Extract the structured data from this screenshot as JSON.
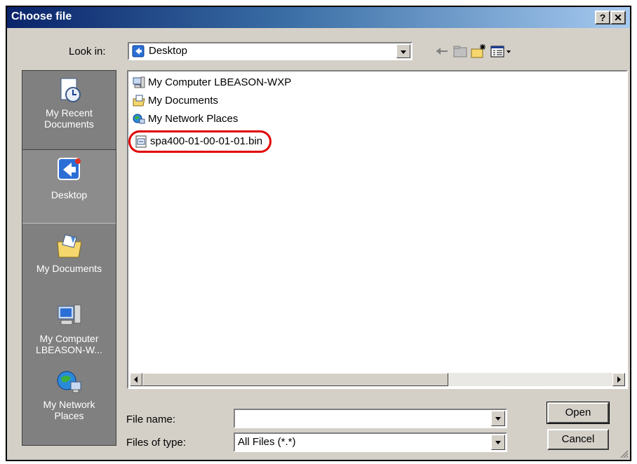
{
  "window": {
    "title": "Choose file",
    "help_button": "?",
    "close_button": "✕"
  },
  "toolbar": {
    "look_in_label": "Look in:",
    "look_in_value": "Desktop"
  },
  "places_bar": {
    "items": [
      {
        "label": "My Recent Documents",
        "icon": "recent-documents-icon"
      },
      {
        "label": "Desktop",
        "icon": "desktop-icon",
        "selected": true
      },
      {
        "label": "My Documents",
        "icon": "my-documents-icon"
      },
      {
        "label": "My Computer LBEASON-W...",
        "icon": "my-computer-icon"
      },
      {
        "label": "My Network Places",
        "icon": "network-places-icon"
      }
    ]
  },
  "file_list": {
    "items": [
      {
        "name": "My Computer LBEASON-WXP",
        "icon": "computer-icon"
      },
      {
        "name": "My Documents",
        "icon": "folder-icon"
      },
      {
        "name": "My Network Places",
        "icon": "network-icon"
      },
      {
        "name": "spa400-01-00-01-01.bin",
        "icon": "bin-file-icon",
        "highlighted": true
      }
    ]
  },
  "form": {
    "file_name_label": "File name:",
    "file_name_value": "",
    "file_type_label": "Files of type:",
    "file_type_value": "All Files (*.*)"
  },
  "buttons": {
    "open": "Open",
    "cancel": "Cancel"
  },
  "colors": {
    "title_start": "#0a246a",
    "title_end": "#a6caf0",
    "dialog_face": "#d4d0c8",
    "highlight_ring": "#e00000"
  }
}
